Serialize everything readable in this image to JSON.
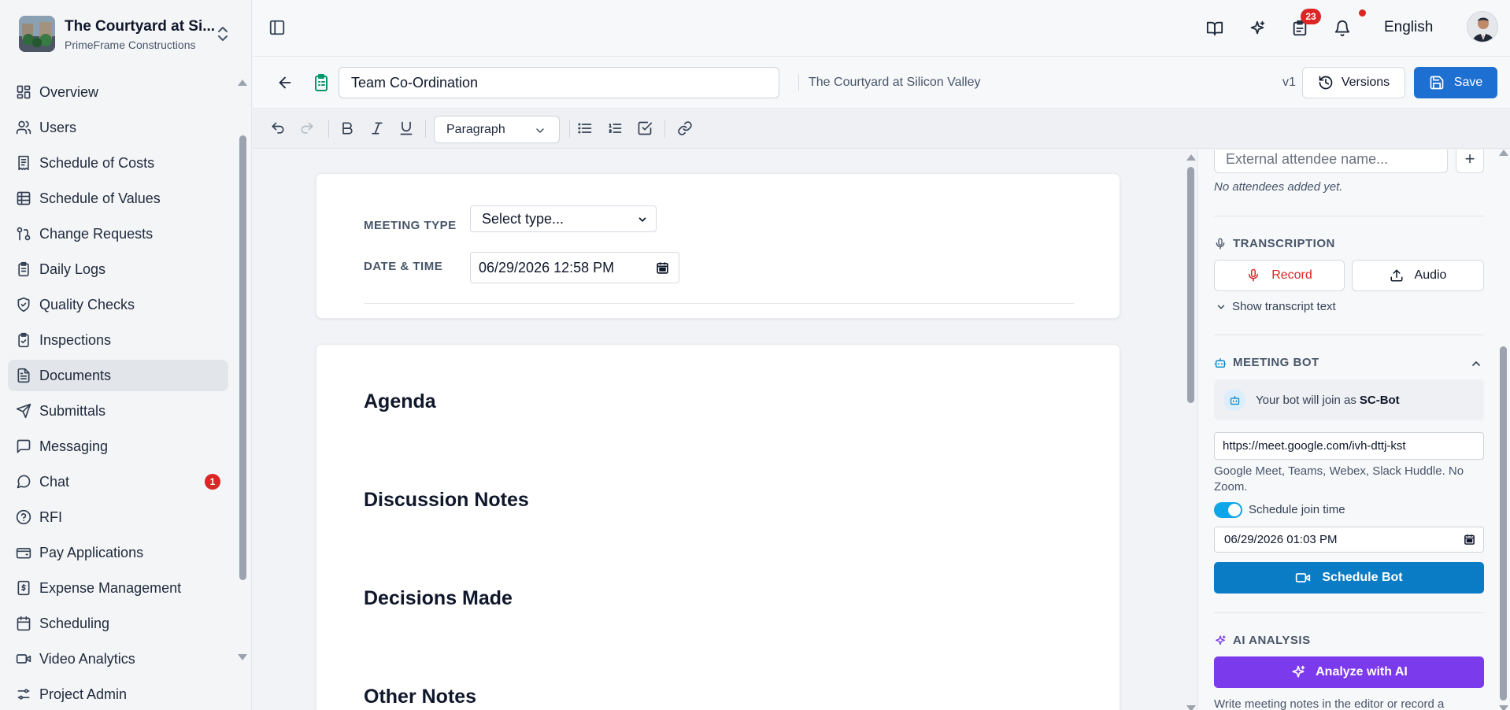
{
  "project": {
    "name": "The Courtyard at Si...",
    "org": "PrimeFrame Constructions"
  },
  "nav": [
    {
      "label": "Overview",
      "icon": "grid-icon"
    },
    {
      "label": "Users",
      "icon": "users-icon"
    },
    {
      "label": "Schedule of Costs",
      "icon": "receipt-icon"
    },
    {
      "label": "Schedule of Values",
      "icon": "table-icon"
    },
    {
      "label": "Change Requests",
      "icon": "git-pull-request-icon"
    },
    {
      "label": "Daily Logs",
      "icon": "clipboard-icon"
    },
    {
      "label": "Quality Checks",
      "icon": "shield-check-icon"
    },
    {
      "label": "Inspections",
      "icon": "clipboard-check-icon"
    },
    {
      "label": "Documents",
      "icon": "file-text-icon",
      "active": true
    },
    {
      "label": "Submittals",
      "icon": "send-icon"
    },
    {
      "label": "Messaging",
      "icon": "message-square-icon"
    },
    {
      "label": "Chat",
      "icon": "message-circle-icon",
      "badge": "1"
    },
    {
      "label": "RFI",
      "icon": "help-circle-icon"
    },
    {
      "label": "Pay Applications",
      "icon": "wallet-icon"
    },
    {
      "label": "Expense Management",
      "icon": "dollar-receipt-icon"
    },
    {
      "label": "Scheduling",
      "icon": "calendar-icon"
    },
    {
      "label": "Video Analytics",
      "icon": "video-icon"
    },
    {
      "label": "Project Admin",
      "icon": "sliders-icon"
    }
  ],
  "topbar": {
    "tasks_badge": "23",
    "language": "English"
  },
  "document": {
    "title": "Team Co-Ordination",
    "project_context": "The Courtyard at Silicon Valley",
    "version": "v1",
    "versions_label": "Versions",
    "save_label": "Save"
  },
  "toolbar": {
    "block_style": "Paragraph"
  },
  "meeting": {
    "type_label": "MEETING TYPE",
    "type_value": "Select type...",
    "datetime_label": "DATE & TIME",
    "datetime_value": "06/29/2026 12:58 PM"
  },
  "sections": [
    "Agenda",
    "Discussion Notes",
    "Decisions Made",
    "Other Notes"
  ],
  "panel": {
    "attendee_placeholder": "External attendee name...",
    "no_attendees": "No attendees added yet.",
    "transcription_title": "TRANSCRIPTION",
    "record_label": "Record",
    "audio_label": "Audio",
    "show_transcript": "Show transcript text",
    "bot_title": "MEETING BOT",
    "bot_join_prefix": "Your bot will join as",
    "bot_name": "SC-Bot",
    "meeting_url": "https://meet.google.com/ivh-dttj-kst",
    "platforms_note": "Google Meet, Teams, Webex, Slack Huddle. No Zoom.",
    "schedule_join_label": "Schedule join time",
    "schedule_join_enabled": true,
    "join_time": "06/29/2026 01:03 PM",
    "schedule_bot_label": "Schedule Bot",
    "ai_title": "AI ANALYSIS",
    "analyze_label": "Analyze with AI",
    "ai_hint": "Write meeting notes in the editor or record a"
  },
  "colors": {
    "primary": "#1d6fd1",
    "bot_button": "#0a7bc5",
    "ai_button": "#7c3aed",
    "record": "#dc2626",
    "badge": "#dc2626"
  }
}
